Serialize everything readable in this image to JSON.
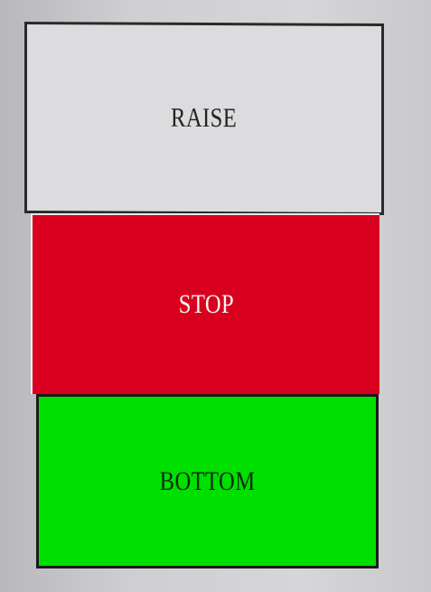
{
  "buttons": {
    "raise": {
      "label": "RAISE",
      "color": "#dcdcde"
    },
    "stop": {
      "label": "STOP",
      "color": "#d8001e"
    },
    "bottom": {
      "label": "BOTTOM",
      "color": "#00e000"
    }
  }
}
